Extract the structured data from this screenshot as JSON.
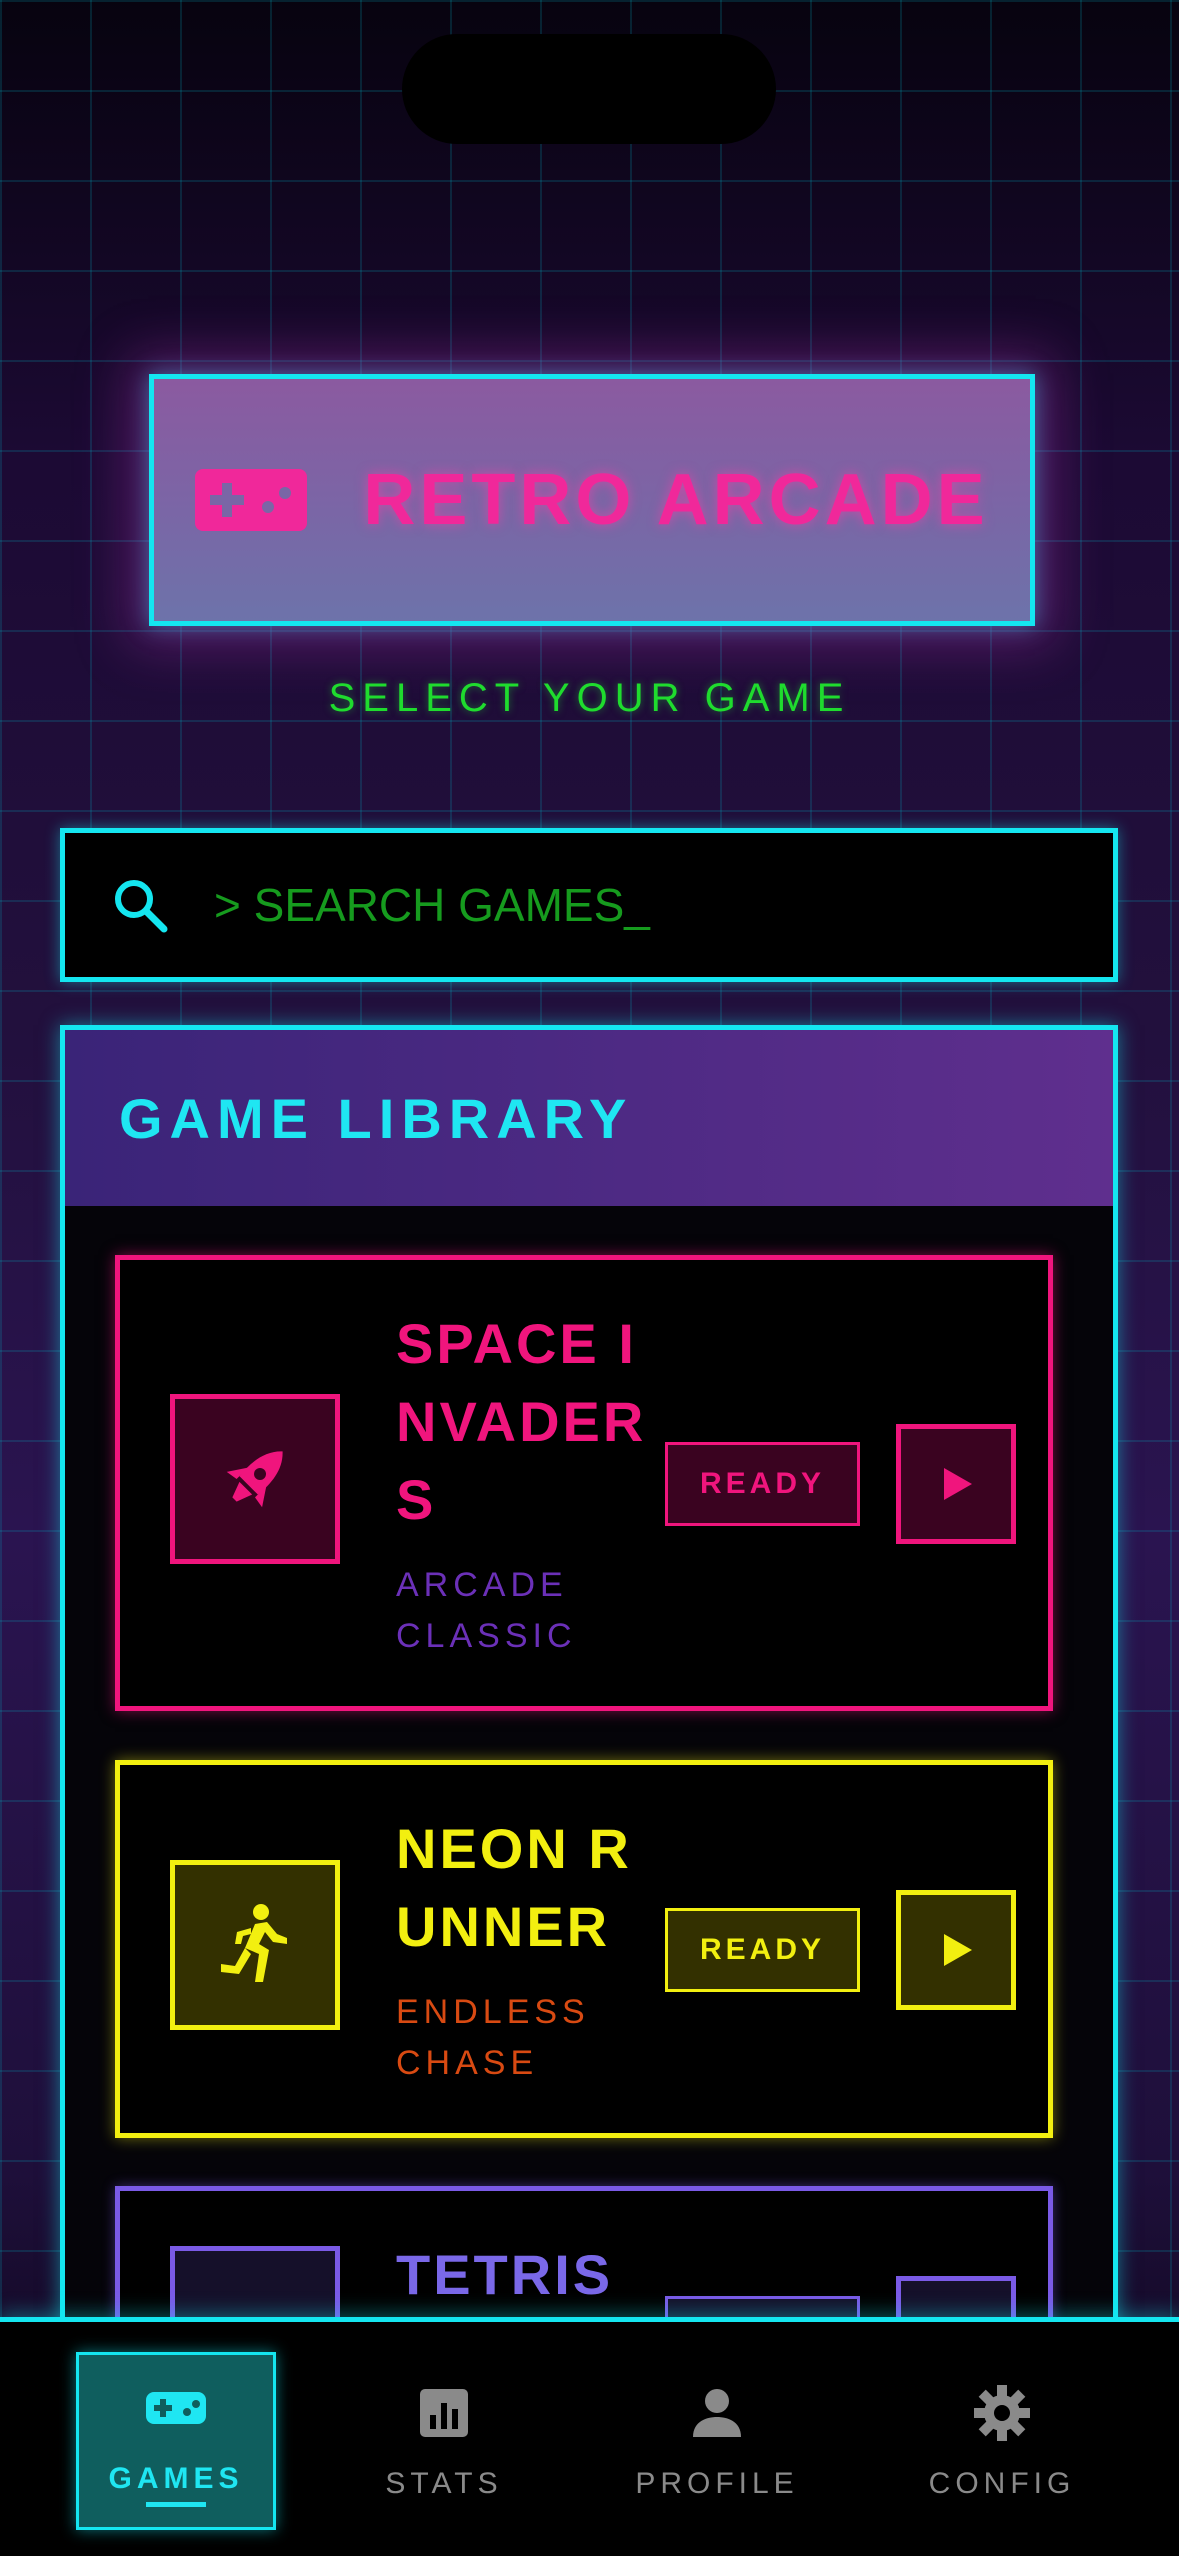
{
  "app": {
    "title": "RETRO ARCADE",
    "subtitle": "SELECT YOUR GAME"
  },
  "search": {
    "placeholder": "> SEARCH GAMES_",
    "icon": "search-icon"
  },
  "library": {
    "title": "GAME LIBRARY",
    "games": [
      {
        "name": "SPACE INVADERS",
        "category": "ARCADE CLASSIC",
        "status": "READY",
        "icon": "rocket-icon",
        "color": "#f0157d"
      },
      {
        "name": "NEON RUNNER",
        "category": "ENDLESS CHASE",
        "status": "READY",
        "icon": "running-person-icon",
        "color": "#f2ef10"
      },
      {
        "name": "TETRIS",
        "category": "",
        "status": "",
        "icon": "blocks-icon",
        "color": "#7a5ae6"
      }
    ]
  },
  "nav": {
    "items": [
      {
        "label": "GAMES",
        "icon": "gamepad-icon",
        "active": true
      },
      {
        "label": "STATS",
        "icon": "bar-chart-icon",
        "active": false
      },
      {
        "label": "PROFILE",
        "icon": "person-icon",
        "active": false
      },
      {
        "label": "CONFIG",
        "icon": "gear-icon",
        "active": false
      }
    ]
  },
  "colors": {
    "cyan": "#14e6f0",
    "pink": "#f0157d",
    "yellow": "#f2ef10",
    "green": "#1fdc2e",
    "purple": "#7a5ae6"
  }
}
